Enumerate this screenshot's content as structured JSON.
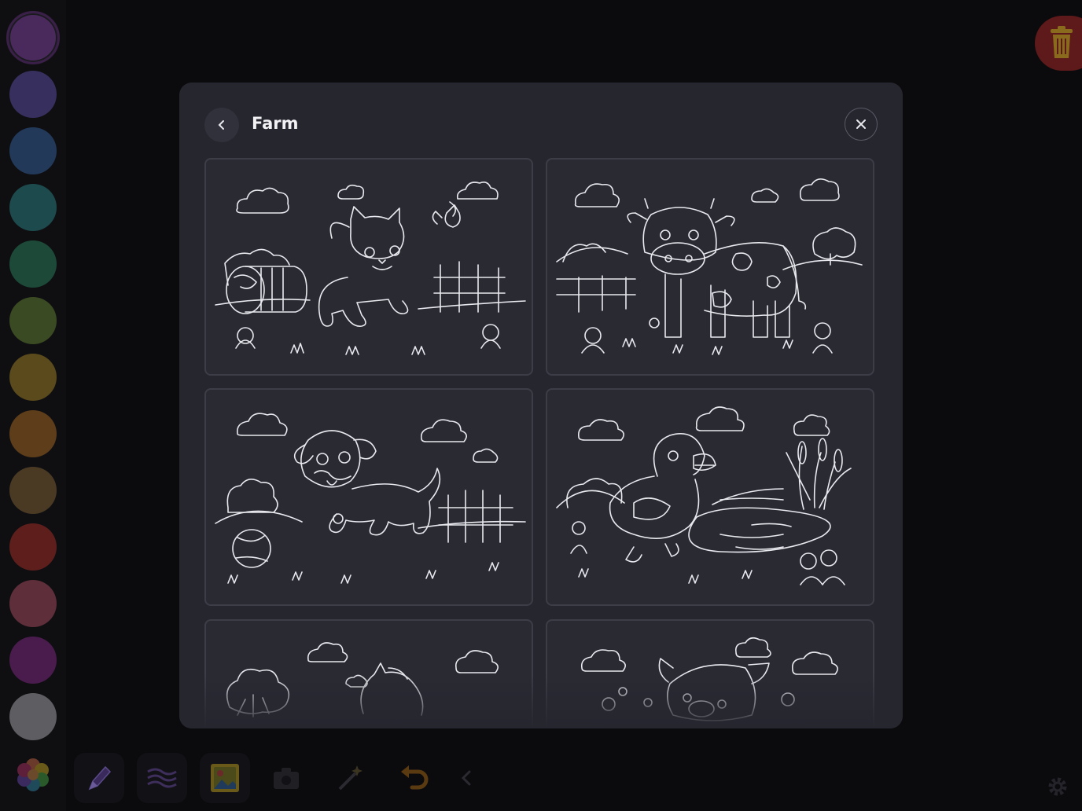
{
  "palette": {
    "swatches": [
      {
        "name": "purple",
        "color": "#4a2a5c",
        "selected": true
      },
      {
        "name": "indigo",
        "color": "#372f5e"
      },
      {
        "name": "blue",
        "color": "#22395a"
      },
      {
        "name": "teal",
        "color": "#1d4a4d"
      },
      {
        "name": "green",
        "color": "#1d4a38"
      },
      {
        "name": "olive",
        "color": "#3a4a22"
      },
      {
        "name": "mustard",
        "color": "#5a4a1c"
      },
      {
        "name": "orange",
        "color": "#5e3d1a"
      },
      {
        "name": "brown",
        "color": "#4a3a24"
      },
      {
        "name": "red",
        "color": "#5e1f1c"
      },
      {
        "name": "pink",
        "color": "#5e2e3a"
      },
      {
        "name": "magenta",
        "color": "#4a1c4d"
      },
      {
        "name": "gray",
        "color": "#5e5e62"
      }
    ]
  },
  "toolbar": {
    "items": [
      {
        "name": "color-wheel-icon"
      },
      {
        "name": "pen-tool-icon"
      },
      {
        "name": "brush-stroke-icon"
      },
      {
        "name": "sticker-picture-icon"
      },
      {
        "name": "camera-icon"
      },
      {
        "name": "magic-wand-icon"
      },
      {
        "name": "undo-icon"
      },
      {
        "name": "chevron-left-icon"
      }
    ]
  },
  "modal": {
    "title": "Farm",
    "cards": [
      {
        "subject": "kitten"
      },
      {
        "subject": "cow"
      },
      {
        "subject": "puppy"
      },
      {
        "subject": "duckling"
      },
      {
        "subject": "horse"
      },
      {
        "subject": "pig"
      }
    ]
  }
}
